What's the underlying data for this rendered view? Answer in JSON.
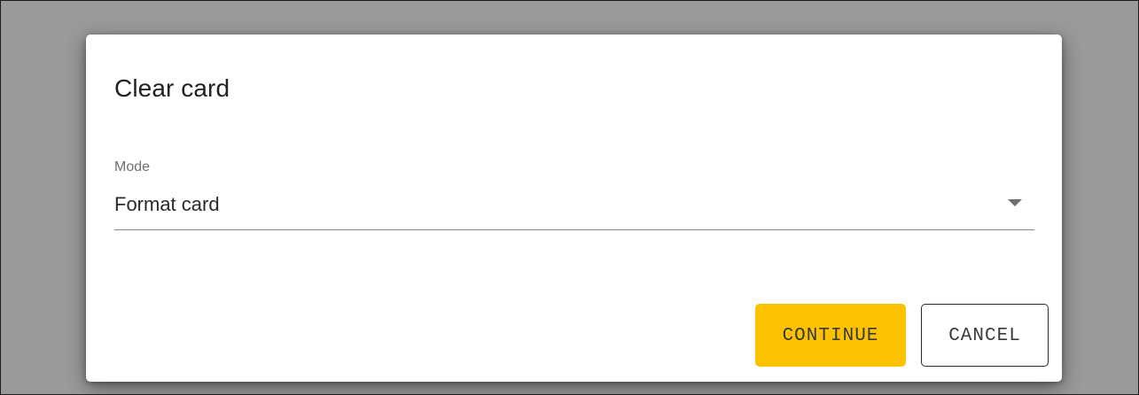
{
  "dialog": {
    "title": "Clear card",
    "mode_field": {
      "label": "Mode",
      "value": "Format card",
      "icon": "chevron-down-icon"
    },
    "buttons": {
      "continue_label": "CONTINUE",
      "cancel_label": "CANCEL"
    }
  },
  "colors": {
    "backdrop": "#9a9a9a",
    "accent": "#fcc200",
    "surface": "#ffffff",
    "text": "#2b2b2b"
  }
}
